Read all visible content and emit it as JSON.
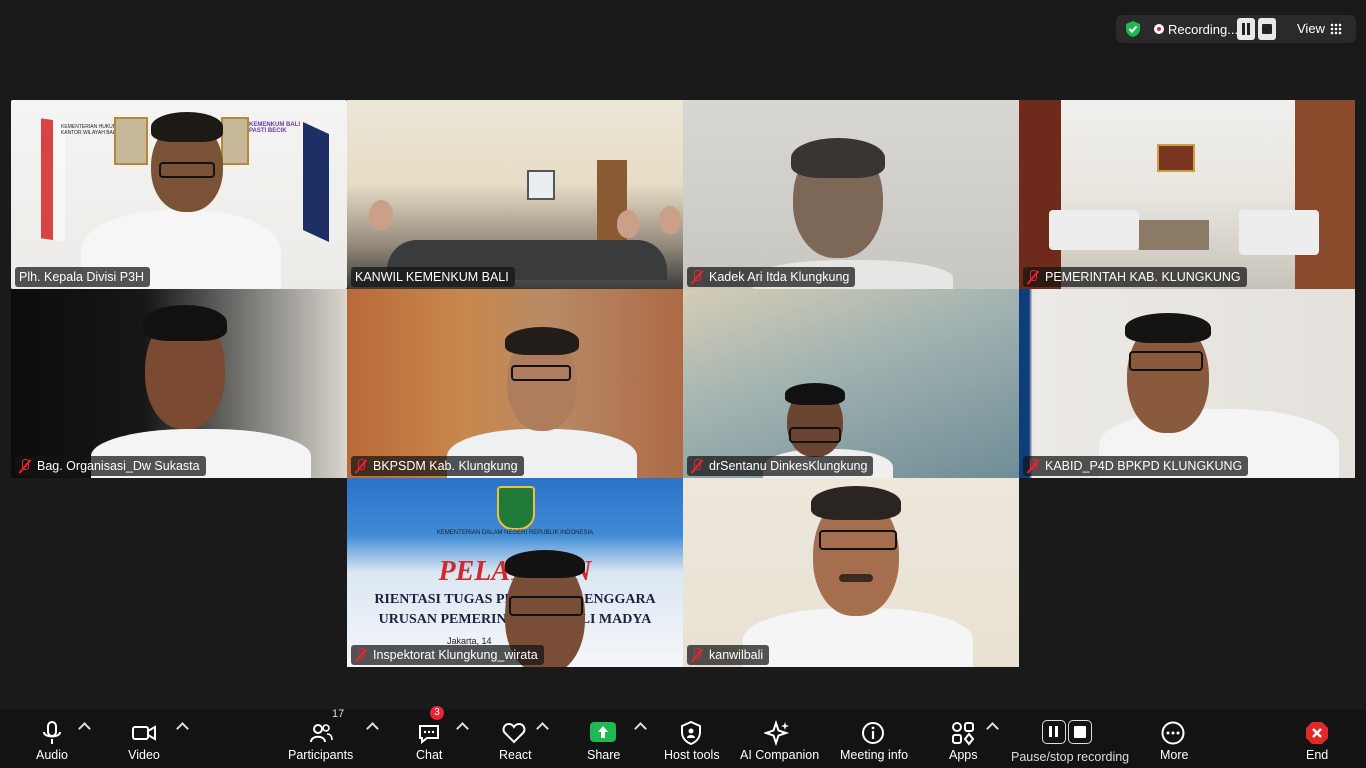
{
  "status_bar": {
    "recording_text": "Recording...",
    "view_label": "View",
    "colors": {
      "shield": "#1fb954",
      "recording_dot": "#e02828"
    }
  },
  "participants": [
    {
      "name": "Plh. Kepala Divisi P3H",
      "muted": false,
      "active_speaker": true
    },
    {
      "name": "KANWIL KEMENKUM BALI",
      "muted": false,
      "active_speaker": false
    },
    {
      "name": "Kadek Ari Itda Klungkung",
      "muted": true,
      "active_speaker": false
    },
    {
      "name": "PEMERINTAH KAB. KLUNGKUNG",
      "muted": true,
      "active_speaker": false
    },
    {
      "name": "Bag. Organisasi_Dw Sukasta",
      "muted": true,
      "active_speaker": false
    },
    {
      "name": "BKPSDM Kab. Klungkung",
      "muted": true,
      "active_speaker": false
    },
    {
      "name": "drSentanu DinkesKlungkung",
      "muted": true,
      "active_speaker": false
    },
    {
      "name": "KABID_P4D BPKPD KLUNGKUNG",
      "muted": true,
      "active_speaker": false
    },
    {
      "name": "Inspektorat Klungkung_wirata",
      "muted": true,
      "active_speaker": false
    },
    {
      "name": "kanwilbali",
      "muted": true,
      "active_speaker": false
    }
  ],
  "tile_texts": {
    "tile1_banner": "KEMENTERIAN HUKUM KANTOR WILAYAH BALI",
    "tile1_logo": "KEMENKUM BALI PASTI BECIK",
    "tile9_ministry": "KEMENTERIAN DALAM NEGERI REPUBLIK INDONESIA",
    "tile9_title": "PELAT    AN",
    "tile9_line1": "RIENTASI TUGAS PENG      YELENGGARA",
    "tile9_line2": "URUSAN PEMERINTAH       AHLI MADYA",
    "tile9_place": "Jakarta, 14"
  },
  "toolbar": {
    "audio": "Audio",
    "video": "Video",
    "participants": "Participants",
    "participants_count": "17",
    "chat": "Chat",
    "chat_badge": "3",
    "react": "React",
    "share": "Share",
    "host_tools": "Host tools",
    "ai_companion": "AI Companion",
    "meeting_info": "Meeting info",
    "apps": "Apps",
    "pause_stop": "Pause/stop recording",
    "more": "More",
    "end": "End",
    "colors": {
      "share": "#1fb954",
      "end": "#e02828",
      "badge": "#e02828"
    }
  }
}
